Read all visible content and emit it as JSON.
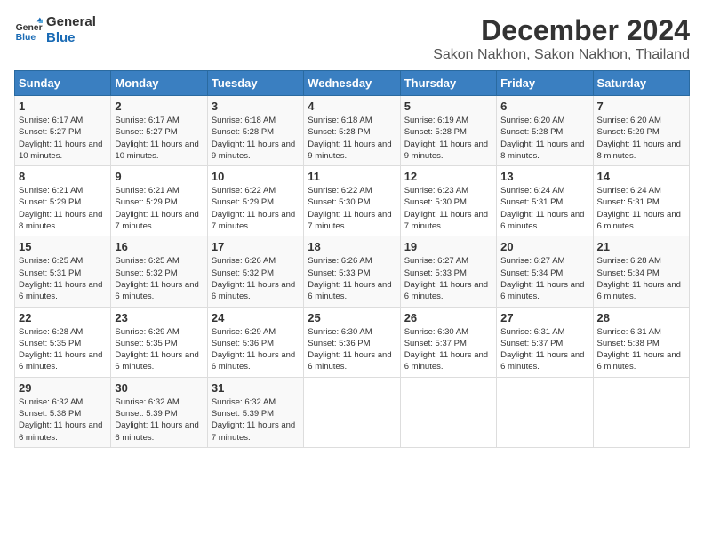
{
  "header": {
    "logo_line1": "General",
    "logo_line2": "Blue",
    "title": "December 2024",
    "subtitle": "Sakon Nakhon, Sakon Nakhon, Thailand"
  },
  "days_of_week": [
    "Sunday",
    "Monday",
    "Tuesday",
    "Wednesday",
    "Thursday",
    "Friday",
    "Saturday"
  ],
  "weeks": [
    [
      {
        "day": "1",
        "sunrise": "6:17 AM",
        "sunset": "5:27 PM",
        "daylight": "11 hours and 10 minutes."
      },
      {
        "day": "2",
        "sunrise": "6:17 AM",
        "sunset": "5:27 PM",
        "daylight": "11 hours and 10 minutes."
      },
      {
        "day": "3",
        "sunrise": "6:18 AM",
        "sunset": "5:28 PM",
        "daylight": "11 hours and 9 minutes."
      },
      {
        "day": "4",
        "sunrise": "6:18 AM",
        "sunset": "5:28 PM",
        "daylight": "11 hours and 9 minutes."
      },
      {
        "day": "5",
        "sunrise": "6:19 AM",
        "sunset": "5:28 PM",
        "daylight": "11 hours and 9 minutes."
      },
      {
        "day": "6",
        "sunrise": "6:20 AM",
        "sunset": "5:28 PM",
        "daylight": "11 hours and 8 minutes."
      },
      {
        "day": "7",
        "sunrise": "6:20 AM",
        "sunset": "5:29 PM",
        "daylight": "11 hours and 8 minutes."
      }
    ],
    [
      {
        "day": "8",
        "sunrise": "6:21 AM",
        "sunset": "5:29 PM",
        "daylight": "11 hours and 8 minutes."
      },
      {
        "day": "9",
        "sunrise": "6:21 AM",
        "sunset": "5:29 PM",
        "daylight": "11 hours and 7 minutes."
      },
      {
        "day": "10",
        "sunrise": "6:22 AM",
        "sunset": "5:29 PM",
        "daylight": "11 hours and 7 minutes."
      },
      {
        "day": "11",
        "sunrise": "6:22 AM",
        "sunset": "5:30 PM",
        "daylight": "11 hours and 7 minutes."
      },
      {
        "day": "12",
        "sunrise": "6:23 AM",
        "sunset": "5:30 PM",
        "daylight": "11 hours and 7 minutes."
      },
      {
        "day": "13",
        "sunrise": "6:24 AM",
        "sunset": "5:31 PM",
        "daylight": "11 hours and 6 minutes."
      },
      {
        "day": "14",
        "sunrise": "6:24 AM",
        "sunset": "5:31 PM",
        "daylight": "11 hours and 6 minutes."
      }
    ],
    [
      {
        "day": "15",
        "sunrise": "6:25 AM",
        "sunset": "5:31 PM",
        "daylight": "11 hours and 6 minutes."
      },
      {
        "day": "16",
        "sunrise": "6:25 AM",
        "sunset": "5:32 PM",
        "daylight": "11 hours and 6 minutes."
      },
      {
        "day": "17",
        "sunrise": "6:26 AM",
        "sunset": "5:32 PM",
        "daylight": "11 hours and 6 minutes."
      },
      {
        "day": "18",
        "sunrise": "6:26 AM",
        "sunset": "5:33 PM",
        "daylight": "11 hours and 6 minutes."
      },
      {
        "day": "19",
        "sunrise": "6:27 AM",
        "sunset": "5:33 PM",
        "daylight": "11 hours and 6 minutes."
      },
      {
        "day": "20",
        "sunrise": "6:27 AM",
        "sunset": "5:34 PM",
        "daylight": "11 hours and 6 minutes."
      },
      {
        "day": "21",
        "sunrise": "6:28 AM",
        "sunset": "5:34 PM",
        "daylight": "11 hours and 6 minutes."
      }
    ],
    [
      {
        "day": "22",
        "sunrise": "6:28 AM",
        "sunset": "5:35 PM",
        "daylight": "11 hours and 6 minutes."
      },
      {
        "day": "23",
        "sunrise": "6:29 AM",
        "sunset": "5:35 PM",
        "daylight": "11 hours and 6 minutes."
      },
      {
        "day": "24",
        "sunrise": "6:29 AM",
        "sunset": "5:36 PM",
        "daylight": "11 hours and 6 minutes."
      },
      {
        "day": "25",
        "sunrise": "6:30 AM",
        "sunset": "5:36 PM",
        "daylight": "11 hours and 6 minutes."
      },
      {
        "day": "26",
        "sunrise": "6:30 AM",
        "sunset": "5:37 PM",
        "daylight": "11 hours and 6 minutes."
      },
      {
        "day": "27",
        "sunrise": "6:31 AM",
        "sunset": "5:37 PM",
        "daylight": "11 hours and 6 minutes."
      },
      {
        "day": "28",
        "sunrise": "6:31 AM",
        "sunset": "5:38 PM",
        "daylight": "11 hours and 6 minutes."
      }
    ],
    [
      {
        "day": "29",
        "sunrise": "6:32 AM",
        "sunset": "5:38 PM",
        "daylight": "11 hours and 6 minutes."
      },
      {
        "day": "30",
        "sunrise": "6:32 AM",
        "sunset": "5:39 PM",
        "daylight": "11 hours and 6 minutes."
      },
      {
        "day": "31",
        "sunrise": "6:32 AM",
        "sunset": "5:39 PM",
        "daylight": "11 hours and 7 minutes."
      },
      null,
      null,
      null,
      null
    ]
  ]
}
